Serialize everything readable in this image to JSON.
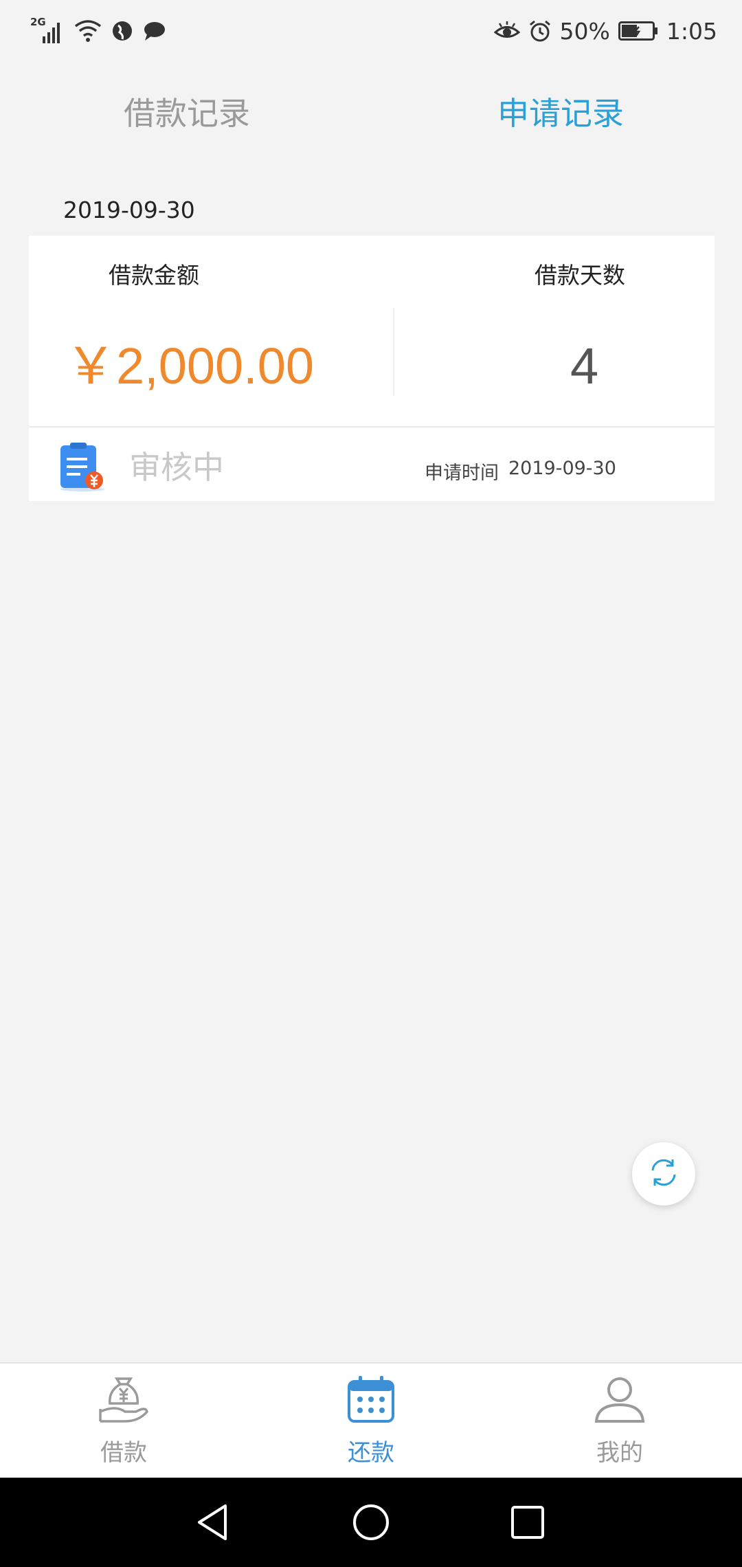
{
  "status_bar": {
    "network": "2G",
    "battery": "50%",
    "time": "1:05",
    "icons": [
      "signal-icon",
      "wifi-icon",
      "globe-icon",
      "chat-icon",
      "eye-icon",
      "alarm-icon",
      "battery-icon"
    ]
  },
  "tabs": [
    {
      "label": "借款记录",
      "active": false
    },
    {
      "label": "申请记录",
      "active": true
    }
  ],
  "record": {
    "date": "2019-09-30",
    "amount_label": "借款金额",
    "days_label": "借款天数",
    "amount": "￥2,000.00",
    "days": "4",
    "status": "审核中",
    "apply_time_label": "申请时间",
    "apply_time": "2019-09-30"
  },
  "bottom_nav": [
    {
      "label": "借款",
      "icon": "money-bag-hand-icon",
      "active": false
    },
    {
      "label": "还款",
      "icon": "calendar-icon",
      "active": true
    },
    {
      "label": "我的",
      "icon": "user-icon",
      "active": false
    }
  ],
  "colors": {
    "accent": "#2aa0d9",
    "amount": "#f0882c",
    "nav_active": "#3d8fd6",
    "inactive": "#9a9a9a",
    "background": "#f3f3f3"
  }
}
